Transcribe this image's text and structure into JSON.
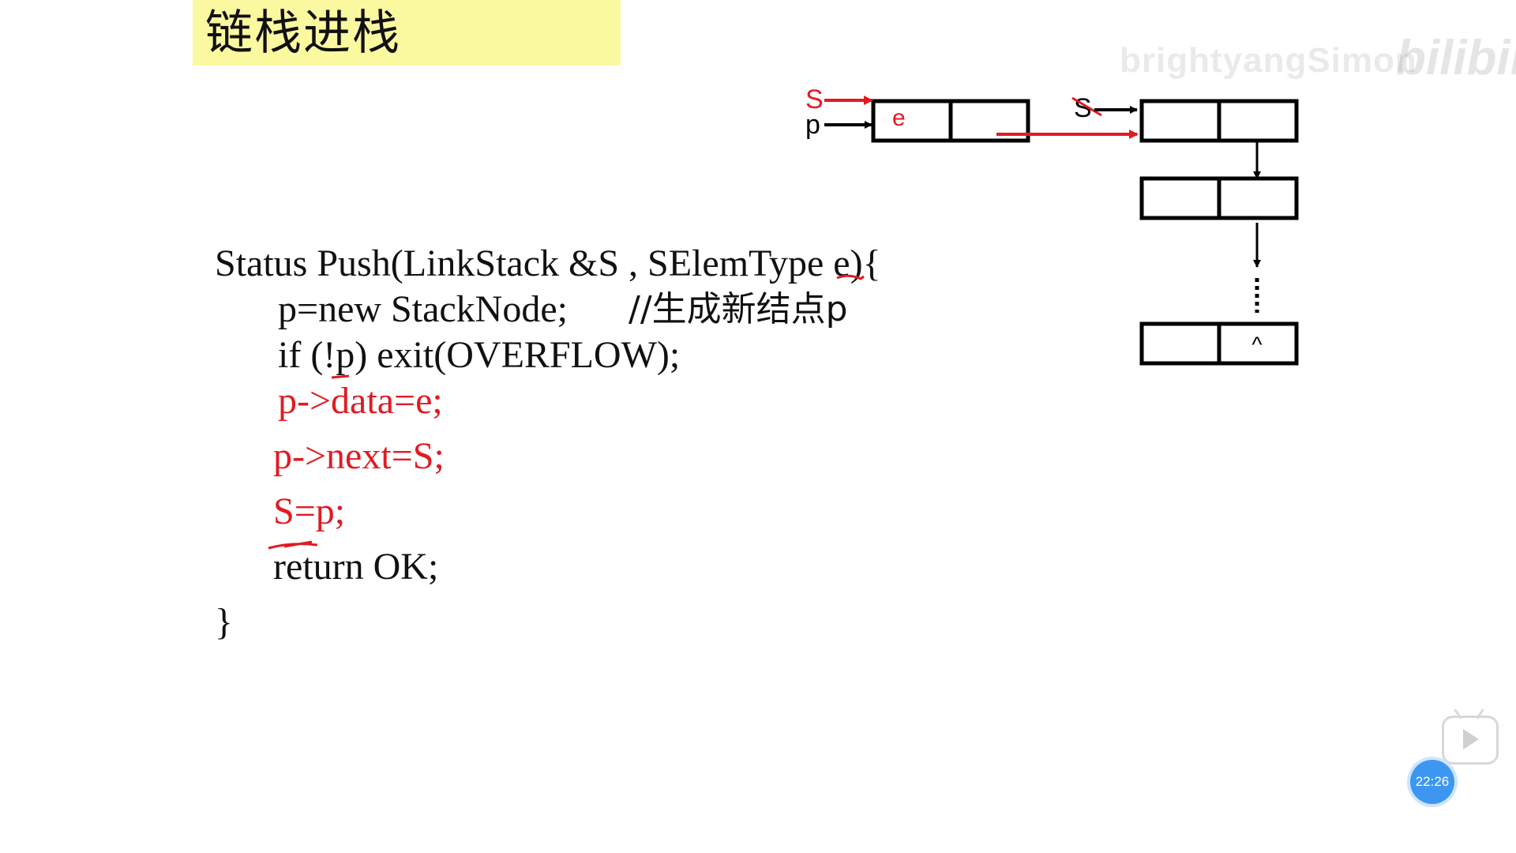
{
  "slide": {
    "title": "链栈进栈",
    "code_lines": [
      "Status Push(LinkStack &S , SElemType e){",
      "p=new StackNode;",
      "//生成新结点p",
      "if (!p) exit(OVERFLOW);",
      "p->data=e;",
      "p->next=S;",
      "S=p;",
      "return OK;",
      "}"
    ]
  },
  "diagram": {
    "labels": {
      "S_new": "S",
      "p": "p",
      "e_value": "e",
      "S_old": "S",
      "null_mark": "^"
    },
    "colors": {
      "highlight": "#e11b22",
      "ink": "#000000"
    }
  },
  "overlay": {
    "watermark": "brightyangSimon",
    "logo": "bilibili",
    "timestamp": "22:26"
  }
}
